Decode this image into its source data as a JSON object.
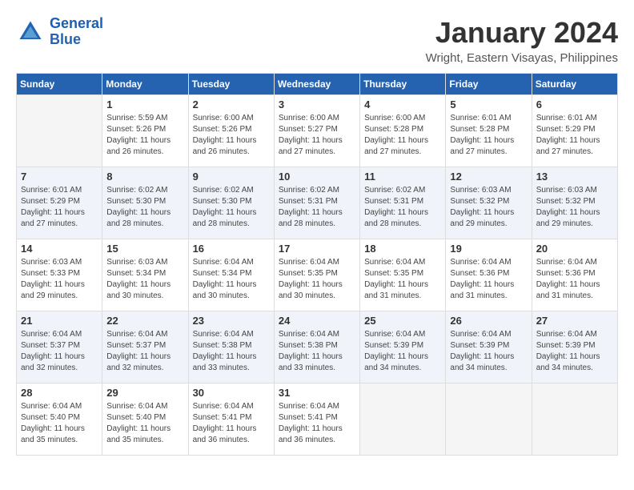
{
  "header": {
    "logo_line1": "General",
    "logo_line2": "Blue",
    "title": "January 2024",
    "subtitle": "Wright, Eastern Visayas, Philippines"
  },
  "days_of_week": [
    "Sunday",
    "Monday",
    "Tuesday",
    "Wednesday",
    "Thursday",
    "Friday",
    "Saturday"
  ],
  "weeks": [
    [
      {
        "day": "",
        "info": ""
      },
      {
        "day": "1",
        "info": "Sunrise: 5:59 AM\nSunset: 5:26 PM\nDaylight: 11 hours\nand 26 minutes."
      },
      {
        "day": "2",
        "info": "Sunrise: 6:00 AM\nSunset: 5:26 PM\nDaylight: 11 hours\nand 26 minutes."
      },
      {
        "day": "3",
        "info": "Sunrise: 6:00 AM\nSunset: 5:27 PM\nDaylight: 11 hours\nand 27 minutes."
      },
      {
        "day": "4",
        "info": "Sunrise: 6:00 AM\nSunset: 5:28 PM\nDaylight: 11 hours\nand 27 minutes."
      },
      {
        "day": "5",
        "info": "Sunrise: 6:01 AM\nSunset: 5:28 PM\nDaylight: 11 hours\nand 27 minutes."
      },
      {
        "day": "6",
        "info": "Sunrise: 6:01 AM\nSunset: 5:29 PM\nDaylight: 11 hours\nand 27 minutes."
      }
    ],
    [
      {
        "day": "7",
        "info": "Sunrise: 6:01 AM\nSunset: 5:29 PM\nDaylight: 11 hours\nand 27 minutes."
      },
      {
        "day": "8",
        "info": "Sunrise: 6:02 AM\nSunset: 5:30 PM\nDaylight: 11 hours\nand 28 minutes."
      },
      {
        "day": "9",
        "info": "Sunrise: 6:02 AM\nSunset: 5:30 PM\nDaylight: 11 hours\nand 28 minutes."
      },
      {
        "day": "10",
        "info": "Sunrise: 6:02 AM\nSunset: 5:31 PM\nDaylight: 11 hours\nand 28 minutes."
      },
      {
        "day": "11",
        "info": "Sunrise: 6:02 AM\nSunset: 5:31 PM\nDaylight: 11 hours\nand 28 minutes."
      },
      {
        "day": "12",
        "info": "Sunrise: 6:03 AM\nSunset: 5:32 PM\nDaylight: 11 hours\nand 29 minutes."
      },
      {
        "day": "13",
        "info": "Sunrise: 6:03 AM\nSunset: 5:32 PM\nDaylight: 11 hours\nand 29 minutes."
      }
    ],
    [
      {
        "day": "14",
        "info": "Sunrise: 6:03 AM\nSunset: 5:33 PM\nDaylight: 11 hours\nand 29 minutes."
      },
      {
        "day": "15",
        "info": "Sunrise: 6:03 AM\nSunset: 5:34 PM\nDaylight: 11 hours\nand 30 minutes."
      },
      {
        "day": "16",
        "info": "Sunrise: 6:04 AM\nSunset: 5:34 PM\nDaylight: 11 hours\nand 30 minutes."
      },
      {
        "day": "17",
        "info": "Sunrise: 6:04 AM\nSunset: 5:35 PM\nDaylight: 11 hours\nand 30 minutes."
      },
      {
        "day": "18",
        "info": "Sunrise: 6:04 AM\nSunset: 5:35 PM\nDaylight: 11 hours\nand 31 minutes."
      },
      {
        "day": "19",
        "info": "Sunrise: 6:04 AM\nSunset: 5:36 PM\nDaylight: 11 hours\nand 31 minutes."
      },
      {
        "day": "20",
        "info": "Sunrise: 6:04 AM\nSunset: 5:36 PM\nDaylight: 11 hours\nand 31 minutes."
      }
    ],
    [
      {
        "day": "21",
        "info": "Sunrise: 6:04 AM\nSunset: 5:37 PM\nDaylight: 11 hours\nand 32 minutes."
      },
      {
        "day": "22",
        "info": "Sunrise: 6:04 AM\nSunset: 5:37 PM\nDaylight: 11 hours\nand 32 minutes."
      },
      {
        "day": "23",
        "info": "Sunrise: 6:04 AM\nSunset: 5:38 PM\nDaylight: 11 hours\nand 33 minutes."
      },
      {
        "day": "24",
        "info": "Sunrise: 6:04 AM\nSunset: 5:38 PM\nDaylight: 11 hours\nand 33 minutes."
      },
      {
        "day": "25",
        "info": "Sunrise: 6:04 AM\nSunset: 5:39 PM\nDaylight: 11 hours\nand 34 minutes."
      },
      {
        "day": "26",
        "info": "Sunrise: 6:04 AM\nSunset: 5:39 PM\nDaylight: 11 hours\nand 34 minutes."
      },
      {
        "day": "27",
        "info": "Sunrise: 6:04 AM\nSunset: 5:39 PM\nDaylight: 11 hours\nand 34 minutes."
      }
    ],
    [
      {
        "day": "28",
        "info": "Sunrise: 6:04 AM\nSunset: 5:40 PM\nDaylight: 11 hours\nand 35 minutes."
      },
      {
        "day": "29",
        "info": "Sunrise: 6:04 AM\nSunset: 5:40 PM\nDaylight: 11 hours\nand 35 minutes."
      },
      {
        "day": "30",
        "info": "Sunrise: 6:04 AM\nSunset: 5:41 PM\nDaylight: 11 hours\nand 36 minutes."
      },
      {
        "day": "31",
        "info": "Sunrise: 6:04 AM\nSunset: 5:41 PM\nDaylight: 11 hours\nand 36 minutes."
      },
      {
        "day": "",
        "info": ""
      },
      {
        "day": "",
        "info": ""
      },
      {
        "day": "",
        "info": ""
      }
    ]
  ]
}
